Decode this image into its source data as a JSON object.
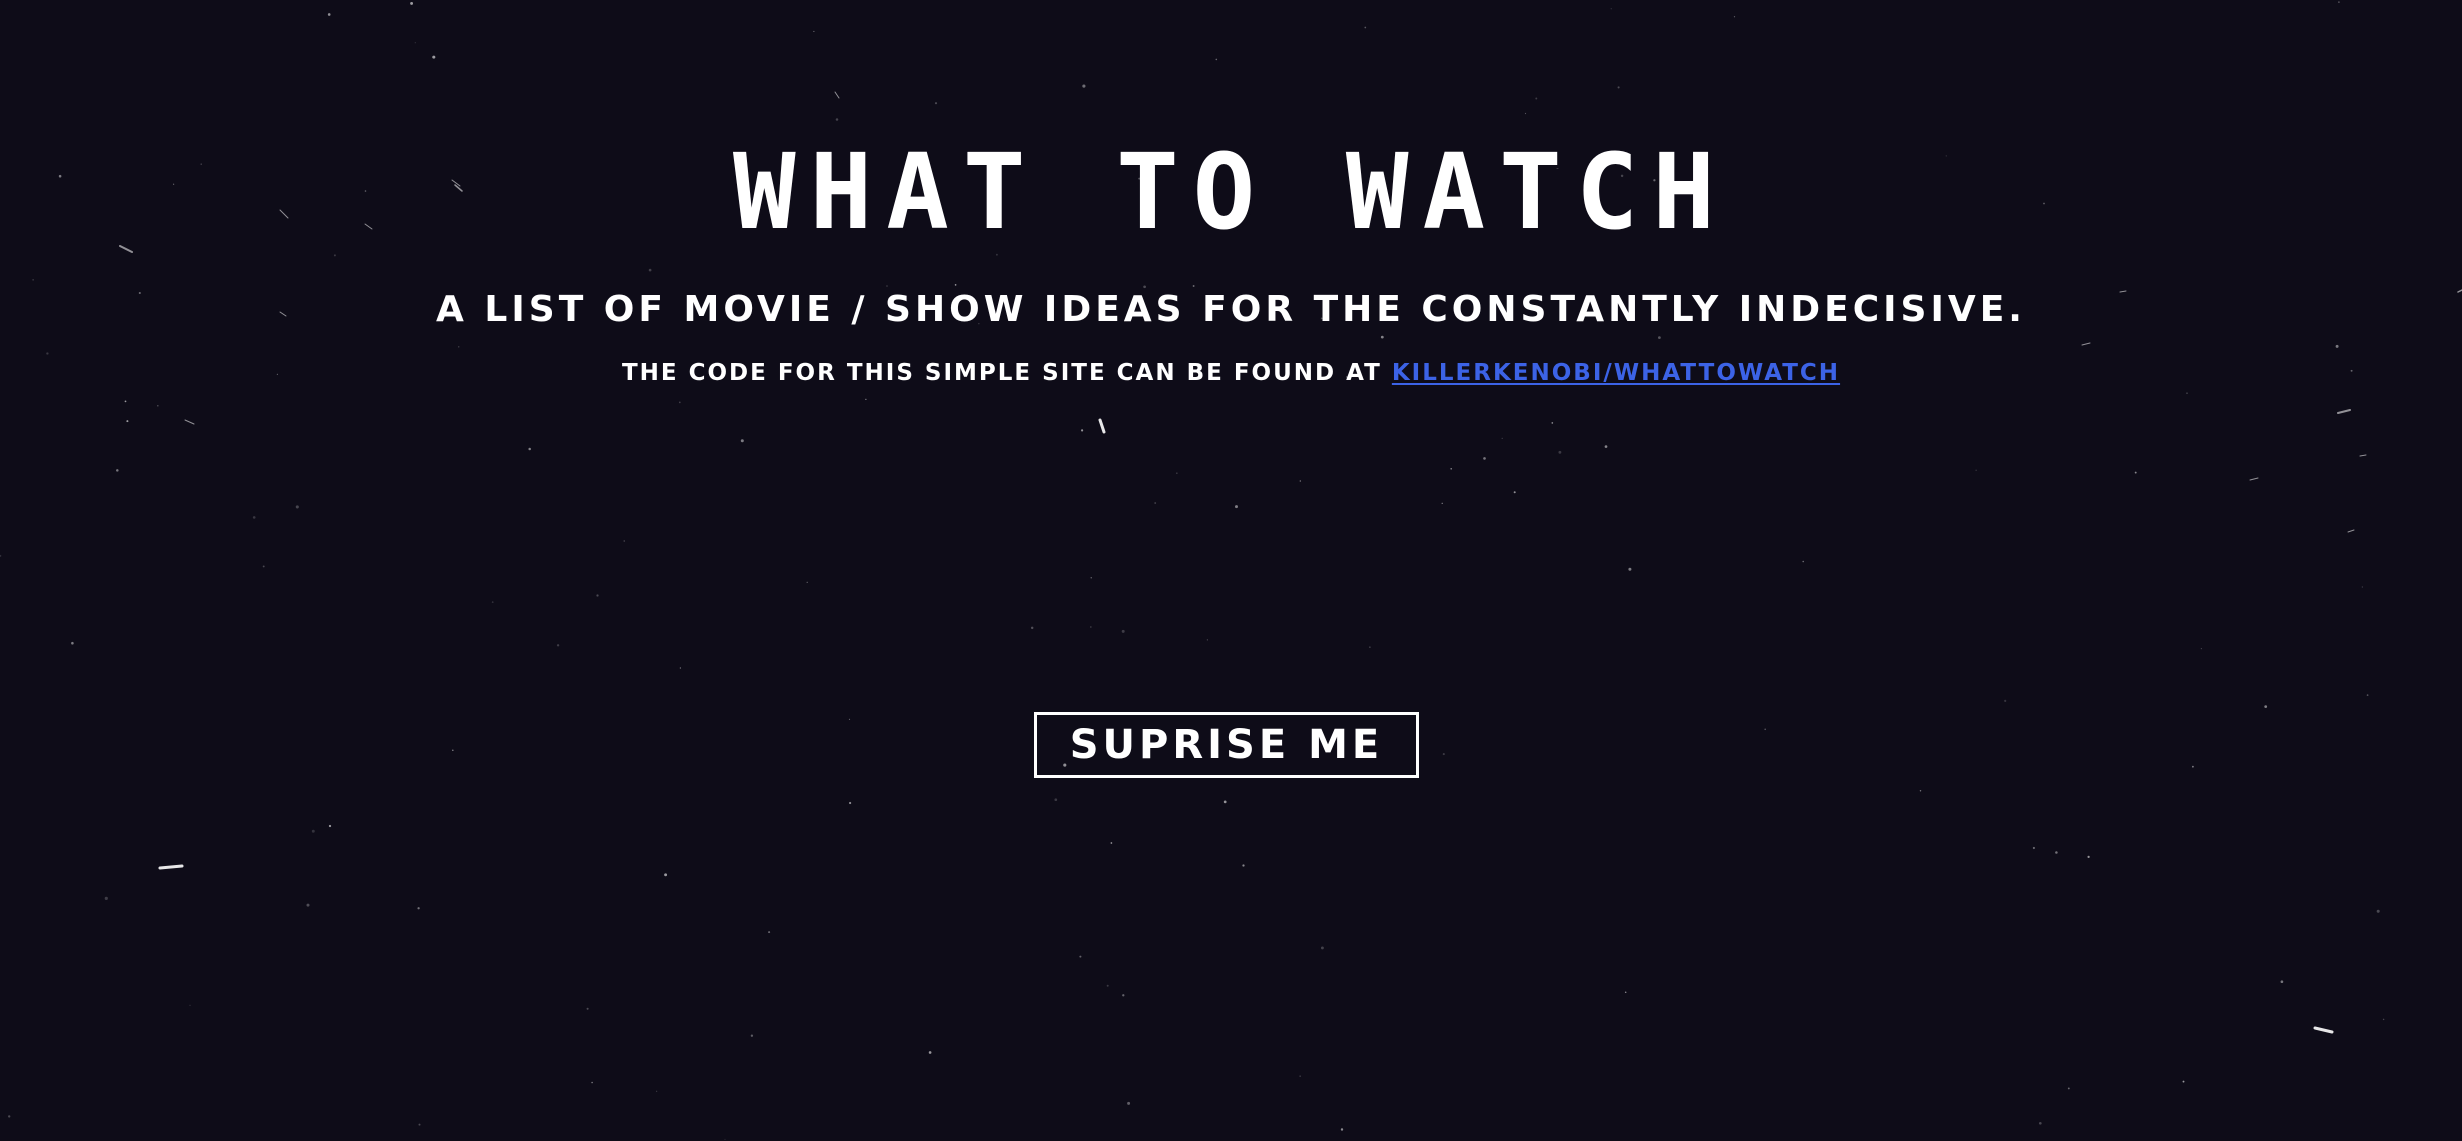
{
  "page": {
    "title": "WHAT TO WATCH",
    "subtitle": "A LIST OF MOVIE / SHOW IDEAS FOR THE CONSTANTLY INDECISIVE.",
    "code_text": "THE CODE FOR THIS SIMPLE SITE CAN BE FOUND AT",
    "repo_link_text": "KILLERKENOBI/WHATTOWATCH",
    "surprise_button_label": "SUPRISE ME"
  },
  "colors": {
    "background": "#0e0c18",
    "text": "#ffffff",
    "link": "#3c63e6"
  }
}
